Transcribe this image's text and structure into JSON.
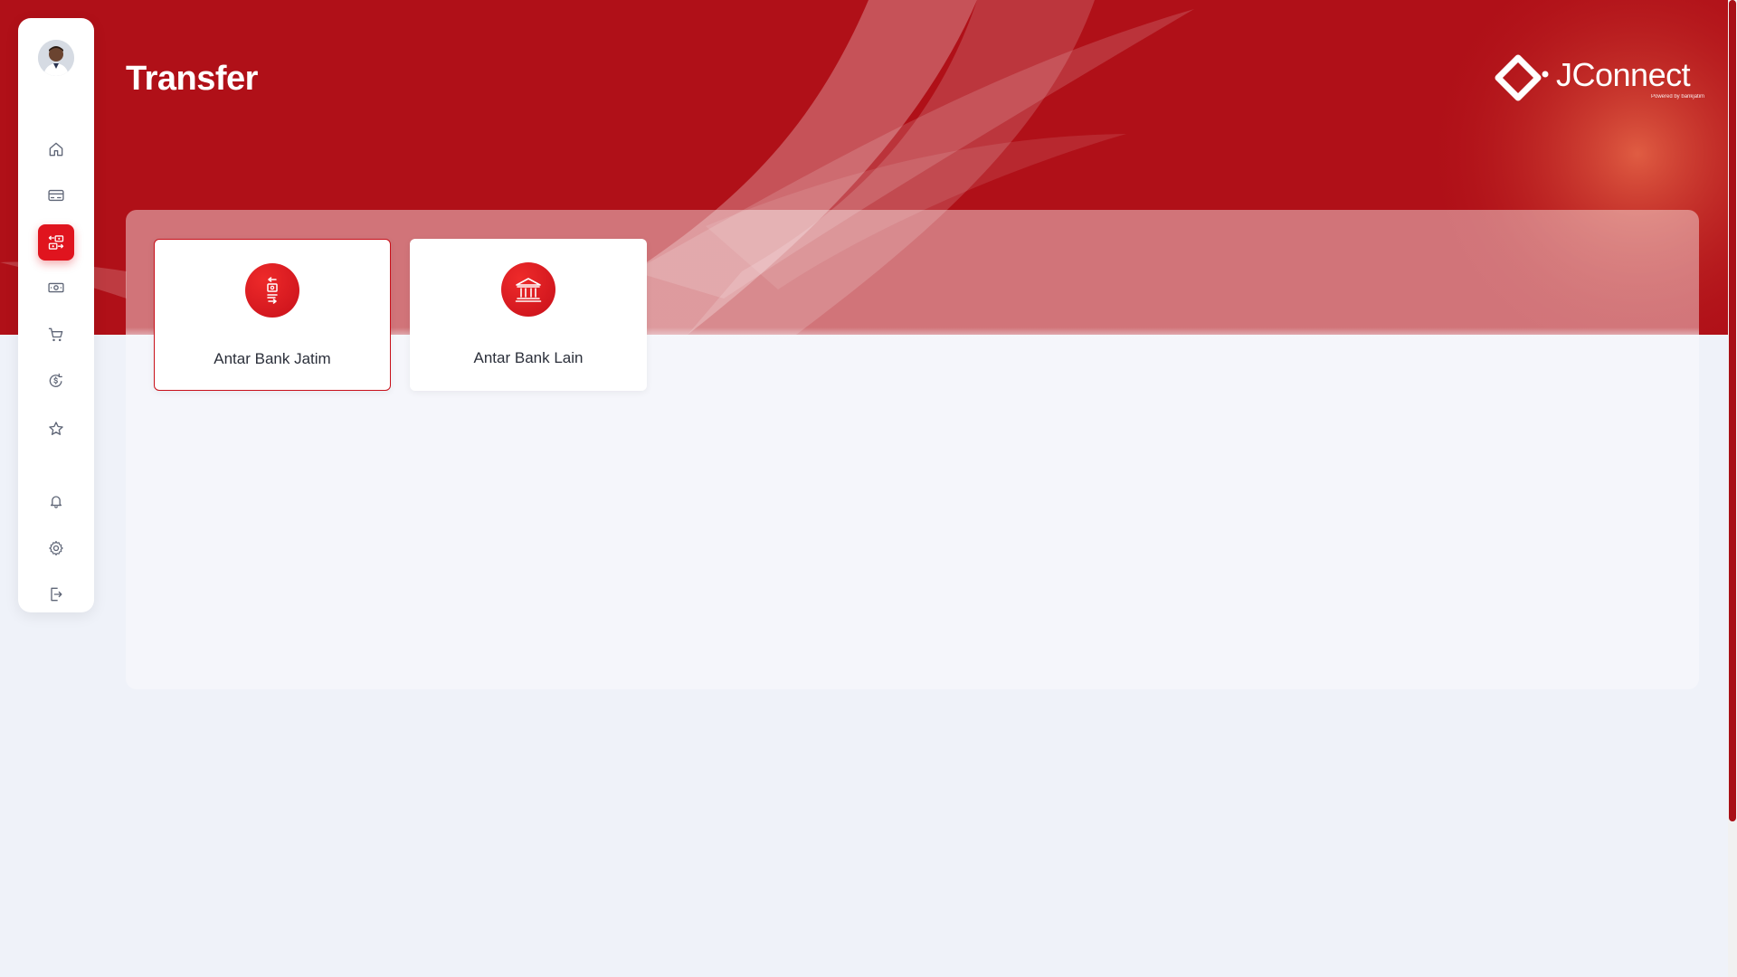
{
  "page": {
    "title": "Transfer"
  },
  "brand": {
    "name": "JConnect",
    "tagline": "Powered by bankjatim"
  },
  "colors": {
    "primary": "#b01018",
    "accent": "#e0141e",
    "background": "#eff2f9"
  },
  "sidebar": {
    "avatar": "user-avatar",
    "items": [
      {
        "name": "home",
        "icon": "home-icon",
        "active": false
      },
      {
        "name": "card",
        "icon": "card-icon",
        "active": false
      },
      {
        "name": "transfer",
        "icon": "transfer-icon",
        "active": true
      },
      {
        "name": "cash",
        "icon": "cash-icon",
        "active": false
      },
      {
        "name": "shopping",
        "icon": "cart-icon",
        "active": false
      },
      {
        "name": "payment",
        "icon": "dollar-refresh-icon",
        "active": false
      },
      {
        "name": "favorites",
        "icon": "star-icon",
        "active": false
      },
      {
        "name": "notifications",
        "icon": "bell-icon",
        "active": false
      },
      {
        "name": "settings",
        "icon": "gear-icon",
        "active": false
      },
      {
        "name": "logout",
        "icon": "logout-icon",
        "active": false
      }
    ]
  },
  "options": [
    {
      "label": "Antar Bank Jatim",
      "icon": "transfer-arrows-icon",
      "selected": true
    },
    {
      "label": "Antar Bank Lain",
      "icon": "bank-building-icon",
      "selected": false
    }
  ]
}
